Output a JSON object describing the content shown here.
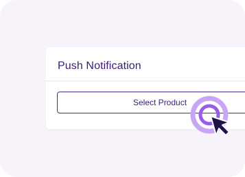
{
  "card": {
    "title": "Push Notification",
    "select_label": "Select Product"
  },
  "icons": {
    "cursor": "click-cursor-icon"
  },
  "colors": {
    "background": "#f8f3fa",
    "accent": "#4b2a8a",
    "text": "#3a1d6e",
    "ring": "#b78bf0",
    "ring_inner": "#9a5be8",
    "cursor": "#22124a"
  }
}
